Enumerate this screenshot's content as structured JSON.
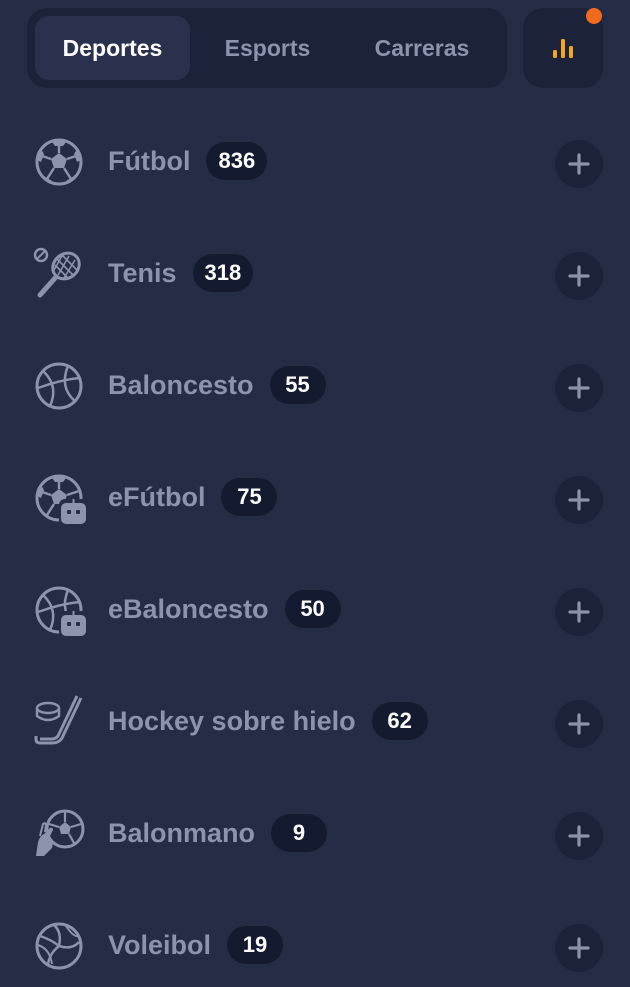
{
  "tabs": {
    "deportes": "Deportes",
    "esports": "Esports",
    "carreras": "Carreras"
  },
  "stats_button": {
    "icon": "bar-chart-icon",
    "accent_color": "#f5a623",
    "notification_color": "#f26a1b"
  },
  "sports": [
    {
      "name": "Fútbol",
      "count": "836",
      "icon": "soccer-ball-icon"
    },
    {
      "name": "Tenis",
      "count": "318",
      "icon": "tennis-racket-icon"
    },
    {
      "name": "Baloncesto",
      "count": "55",
      "icon": "basketball-icon"
    },
    {
      "name": "eFútbol",
      "count": "75",
      "icon": "esoccer-icon"
    },
    {
      "name": "eBaloncesto",
      "count": "50",
      "icon": "ebasketball-icon"
    },
    {
      "name": "Hockey sobre hielo",
      "count": "62",
      "icon": "ice-hockey-icon"
    },
    {
      "name": "Balonmano",
      "count": "9",
      "icon": "handball-icon"
    },
    {
      "name": "Voleibol",
      "count": "19",
      "icon": "volleyball-icon"
    }
  ],
  "colors": {
    "background": "#252c45",
    "panel": "#1c223a",
    "active_tab": "#2a314c",
    "muted_text": "#8b93ad",
    "badge": "#141a30"
  }
}
